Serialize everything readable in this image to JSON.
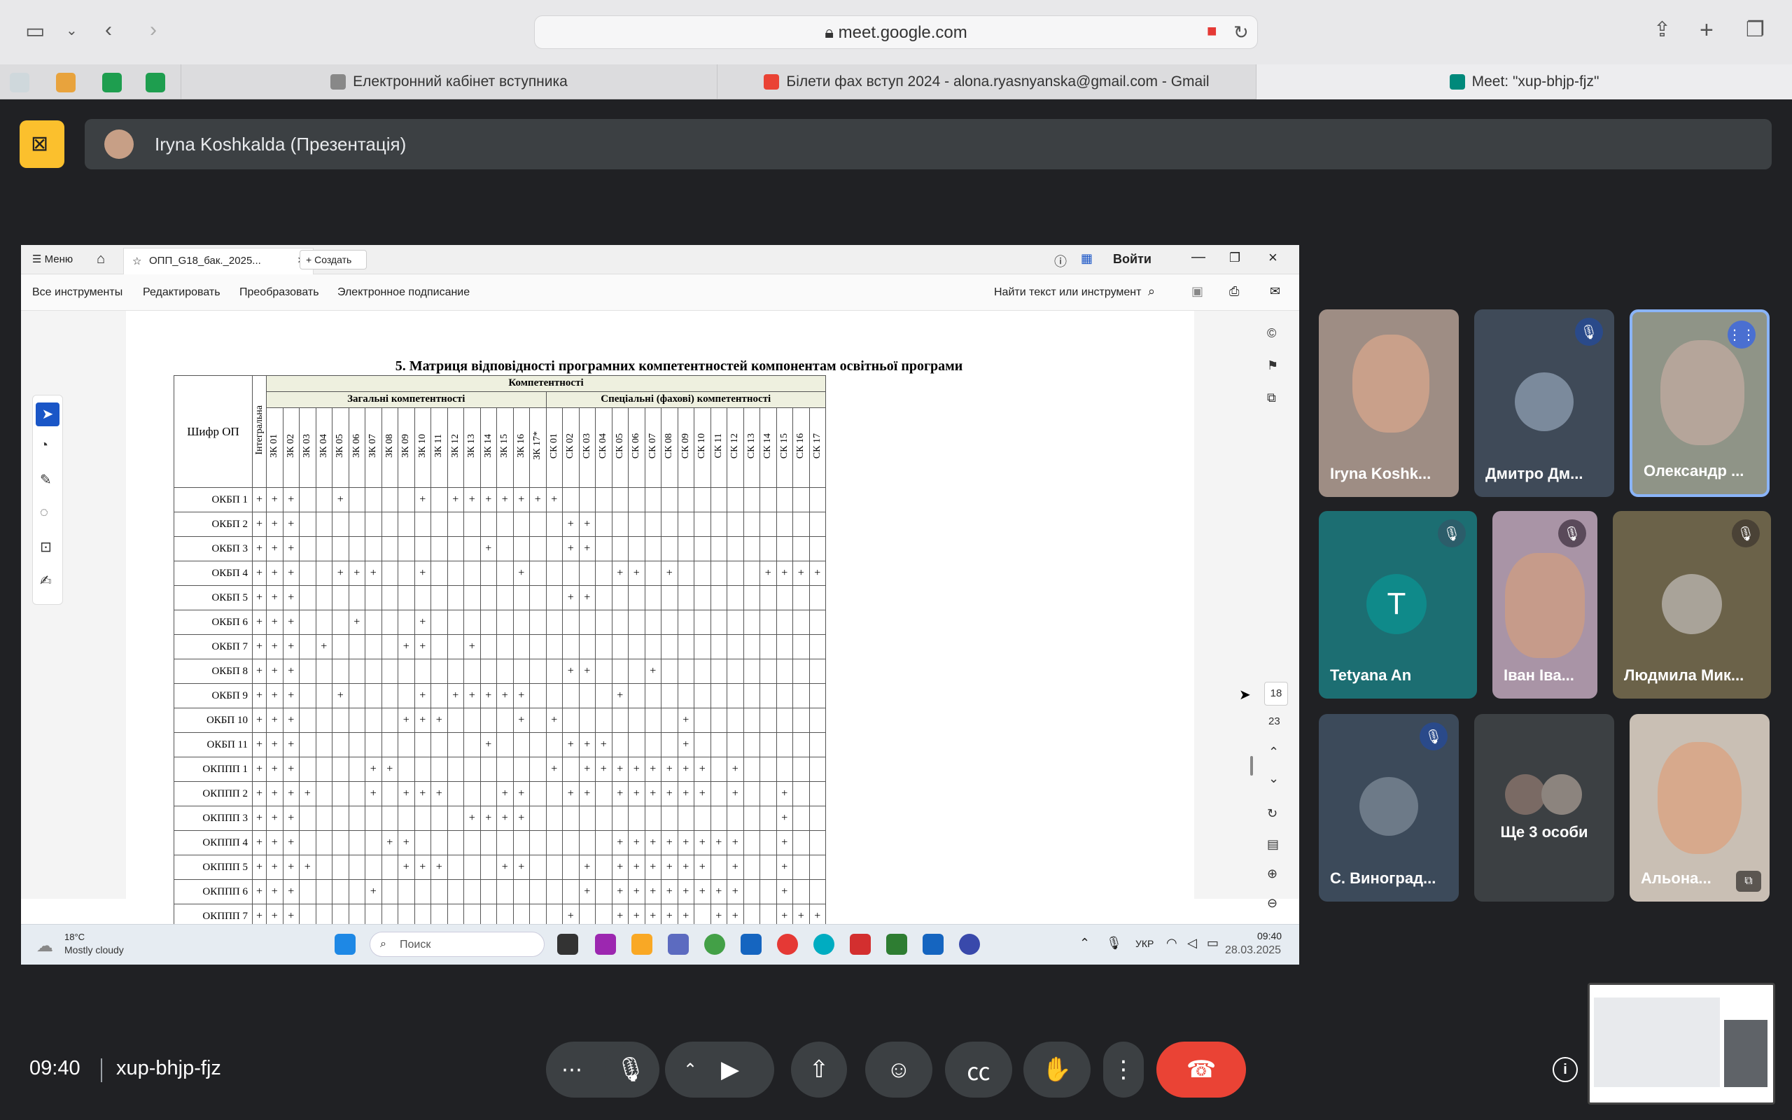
{
  "browser": {
    "url": "meet.google.com",
    "tabs": [
      {
        "label": "Електронний кабінет вступника",
        "favicon": "E"
      },
      {
        "label": "Білети фах вступ 2024 - alona.ryasnyanska@gmail.com - Gmail"
      },
      {
        "label": "Meet: \"xup-bhjp-fjz\""
      }
    ]
  },
  "meet": {
    "presenter_label": "Iryna Koshkalda (Презентація)",
    "time": "09:40",
    "code": "xup-bhjp-fjz"
  },
  "acrobat": {
    "menu": "Меню",
    "doc_tab": "ОПП_G18_бак._2025...",
    "create": "Создать",
    "signin": "Войти",
    "tools": [
      "Все инструменты",
      "Редактировать",
      "Преобразовать",
      "Электронное подписание"
    ],
    "search_label": "Найти текст или инструмент",
    "page_current": "18",
    "page_total": "23"
  },
  "document": {
    "heading": "5.  Матриця відповідності програмних компетентностей компонентам освітньої програми",
    "corner_label": "Шифр ОП",
    "competences_header": "Компетентності",
    "general_header": "Загальні компетентності",
    "special_header": "Спеціальні (фахові) компетентності",
    "integral_label": "Інтегральна",
    "zk_columns": [
      "ЗК 01",
      "ЗК 02",
      "ЗК 03",
      "ЗК 04",
      "ЗК 05",
      "ЗК 06",
      "ЗК 07",
      "ЗК 08",
      "ЗК 09",
      "ЗК 10",
      "ЗК 11",
      "ЗК 12",
      "ЗК 13",
      "ЗК 14",
      "ЗК 15",
      "ЗК 16",
      "ЗК 17*"
    ],
    "sk_columns": [
      "СК 01",
      "СК 02",
      "СК 03",
      "СК 04",
      "СК 05",
      "СК 06",
      "СК 07",
      "СК 08",
      "СК 09",
      "СК 10",
      "СК 11",
      "СК 12",
      "СК 13",
      "СК 14",
      "СК 15",
      "СК 16",
      "СК 17"
    ],
    "rows": [
      {
        "label": "ОКБП 1",
        "marks": [
          0,
          1,
          2,
          5,
          10,
          12,
          13,
          14,
          15,
          16,
          17,
          18
        ]
      },
      {
        "label": "ОКБП 2",
        "marks": [
          0,
          1,
          2,
          19,
          20
        ]
      },
      {
        "label": "ОКБП 3",
        "marks": [
          0,
          1,
          2,
          14,
          19,
          20
        ]
      },
      {
        "label": "ОКБП 4",
        "marks": [
          0,
          1,
          2,
          5,
          6,
          7,
          10,
          16,
          22,
          23,
          25,
          31,
          32,
          33,
          34
        ]
      },
      {
        "label": "ОКБП 5",
        "marks": [
          0,
          1,
          2,
          19,
          20
        ]
      },
      {
        "label": "ОКБП 6",
        "marks": [
          0,
          1,
          2,
          6,
          10
        ]
      },
      {
        "label": "ОКБП 7",
        "marks": [
          0,
          1,
          2,
          4,
          9,
          10,
          13
        ]
      },
      {
        "label": "ОКБП 8",
        "marks": [
          0,
          1,
          2,
          19,
          20,
          24
        ]
      },
      {
        "label": "ОКБП 9",
        "marks": [
          0,
          1,
          2,
          5,
          10,
          12,
          13,
          14,
          15,
          16,
          22
        ]
      },
      {
        "label": "ОКБП 10",
        "marks": [
          0,
          1,
          2,
          9,
          10,
          11,
          16,
          18,
          26
        ]
      },
      {
        "label": "ОКБП 11",
        "marks": [
          0,
          1,
          2,
          14,
          19,
          20,
          21,
          26
        ]
      },
      {
        "label": "ОКППП 1",
        "marks": [
          0,
          1,
          2,
          7,
          8,
          18,
          20,
          21,
          22,
          23,
          24,
          25,
          26,
          27,
          29
        ]
      },
      {
        "label": "ОКППП 2",
        "marks": [
          0,
          1,
          2,
          3,
          7,
          9,
          10,
          11,
          15,
          16,
          19,
          20,
          22,
          23,
          24,
          25,
          26,
          27,
          29,
          32
        ]
      },
      {
        "label": "ОКППП 3",
        "marks": [
          0,
          1,
          2,
          13,
          14,
          15,
          16,
          32
        ]
      },
      {
        "label": "ОКППП 4",
        "marks": [
          0,
          1,
          2,
          8,
          9,
          22,
          23,
          24,
          25,
          26,
          27,
          28,
          29,
          32
        ]
      },
      {
        "label": "ОКППП 5",
        "marks": [
          0,
          1,
          2,
          3,
          9,
          10,
          11,
          15,
          16,
          20,
          22,
          23,
          24,
          25,
          26,
          27,
          29,
          32
        ]
      },
      {
        "label": "ОКППП 6",
        "marks": [
          0,
          1,
          2,
          7,
          20,
          22,
          23,
          24,
          25,
          26,
          27,
          28,
          29,
          32
        ]
      },
      {
        "label": "ОКППП 7",
        "marks": [
          0,
          1,
          2,
          19,
          22,
          23,
          24,
          25,
          26,
          28,
          29,
          32,
          33,
          34
        ]
      }
    ]
  },
  "taskbar": {
    "temp": "18°C",
    "weather": "Mostly cloudy",
    "search": "Поиск",
    "lang": "УКР",
    "time": "09:40",
    "date": "28.03.2025"
  },
  "participants": [
    {
      "name": "Iryna Koshk...",
      "muted": false
    },
    {
      "name": "Дмитро Дм...",
      "muted": true
    },
    {
      "name": "Олександр ...",
      "speaking": true
    },
    {
      "name": "Tetyana An",
      "muted": true,
      "initial": "T"
    },
    {
      "name": "Іван Іва...",
      "muted": true
    },
    {
      "name": "Людмила Мик...",
      "muted": true
    },
    {
      "name": "С. Виноград...",
      "muted": true
    },
    {
      "name": "Ще 3 особи"
    },
    {
      "name": "Альона..."
    }
  ],
  "colors": {
    "accent_yellow": "#fbc02d",
    "end_call": "#ea4335",
    "meet_bg": "#202124"
  }
}
